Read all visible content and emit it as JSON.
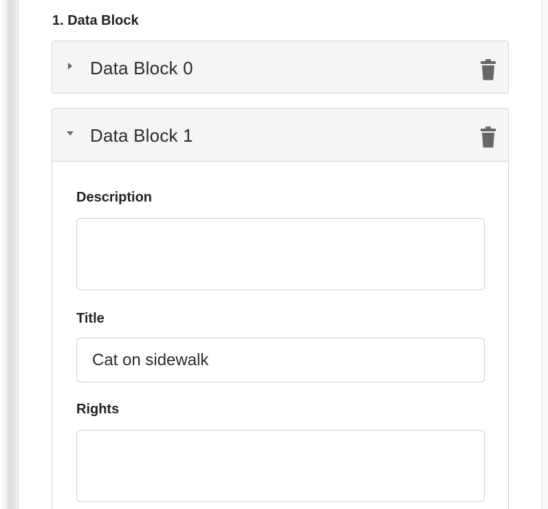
{
  "section": {
    "heading": "1. Data Block"
  },
  "blocks": [
    {
      "title": "Data Block 0",
      "expanded": false,
      "caret_icon": "caret-right-icon",
      "delete_icon": "trash-icon"
    },
    {
      "title": "Data Block 1",
      "expanded": true,
      "caret_icon": "caret-down-icon",
      "delete_icon": "trash-icon",
      "fields": {
        "description": {
          "label": "Description",
          "value": ""
        },
        "title": {
          "label": "Title",
          "value": "Cat on sidewalk"
        },
        "rights": {
          "label": "Rights",
          "value": ""
        }
      }
    }
  ],
  "colors": {
    "header_bg": "#f5f5f5",
    "border": "#d3d3d3",
    "icon": "#666666",
    "text": "#222222"
  }
}
